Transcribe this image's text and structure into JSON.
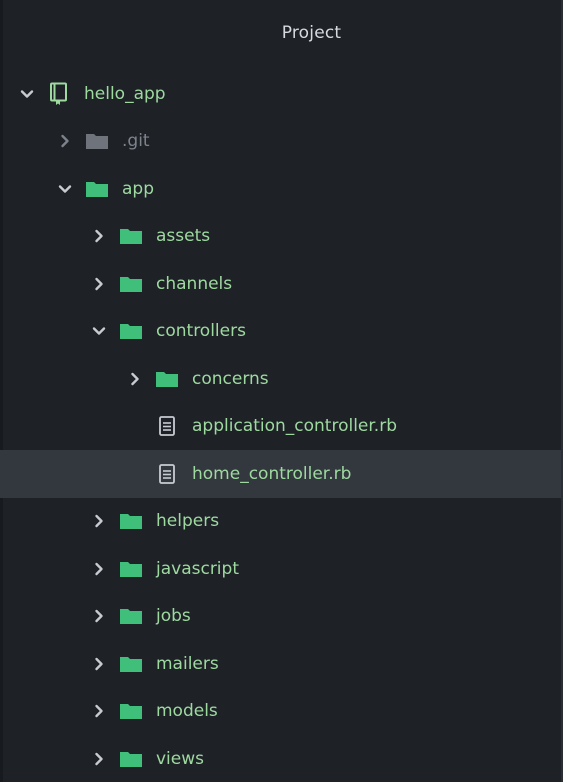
{
  "panel": {
    "title": "Project"
  },
  "colors": {
    "background": "#1e2227",
    "selected_row": "#33373e",
    "folder_green": "#3fbf7a",
    "folder_gray": "#6f747c",
    "text_green": "#9ed9a0",
    "text_muted": "#7d838c"
  },
  "tree": [
    {
      "label": "hello_app",
      "type": "repo",
      "state": "expanded",
      "depth": 0,
      "icon": "repo-icon"
    },
    {
      "label": ".git",
      "type": "folder",
      "state": "collapsed",
      "depth": 1,
      "icon": "folder-icon",
      "muted": true
    },
    {
      "label": "app",
      "type": "folder",
      "state": "expanded",
      "depth": 1,
      "icon": "folder-icon"
    },
    {
      "label": "assets",
      "type": "folder",
      "state": "collapsed",
      "depth": 2,
      "icon": "folder-icon"
    },
    {
      "label": "channels",
      "type": "folder",
      "state": "collapsed",
      "depth": 2,
      "icon": "folder-icon"
    },
    {
      "label": "controllers",
      "type": "folder",
      "state": "expanded",
      "depth": 2,
      "icon": "folder-icon"
    },
    {
      "label": "concerns",
      "type": "folder",
      "state": "collapsed",
      "depth": 3,
      "icon": "folder-icon"
    },
    {
      "label": "application_controller.rb",
      "type": "file",
      "depth": 3,
      "icon": "file-icon"
    },
    {
      "label": "home_controller.rb",
      "type": "file",
      "depth": 3,
      "icon": "file-icon",
      "selected": true
    },
    {
      "label": "helpers",
      "type": "folder",
      "state": "collapsed",
      "depth": 2,
      "icon": "folder-icon"
    },
    {
      "label": "javascript",
      "type": "folder",
      "state": "collapsed",
      "depth": 2,
      "icon": "folder-icon"
    },
    {
      "label": "jobs",
      "type": "folder",
      "state": "collapsed",
      "depth": 2,
      "icon": "folder-icon"
    },
    {
      "label": "mailers",
      "type": "folder",
      "state": "collapsed",
      "depth": 2,
      "icon": "folder-icon"
    },
    {
      "label": "models",
      "type": "folder",
      "state": "collapsed",
      "depth": 2,
      "icon": "folder-icon"
    },
    {
      "label": "views",
      "type": "folder",
      "state": "collapsed",
      "depth": 2,
      "icon": "folder-icon"
    }
  ]
}
